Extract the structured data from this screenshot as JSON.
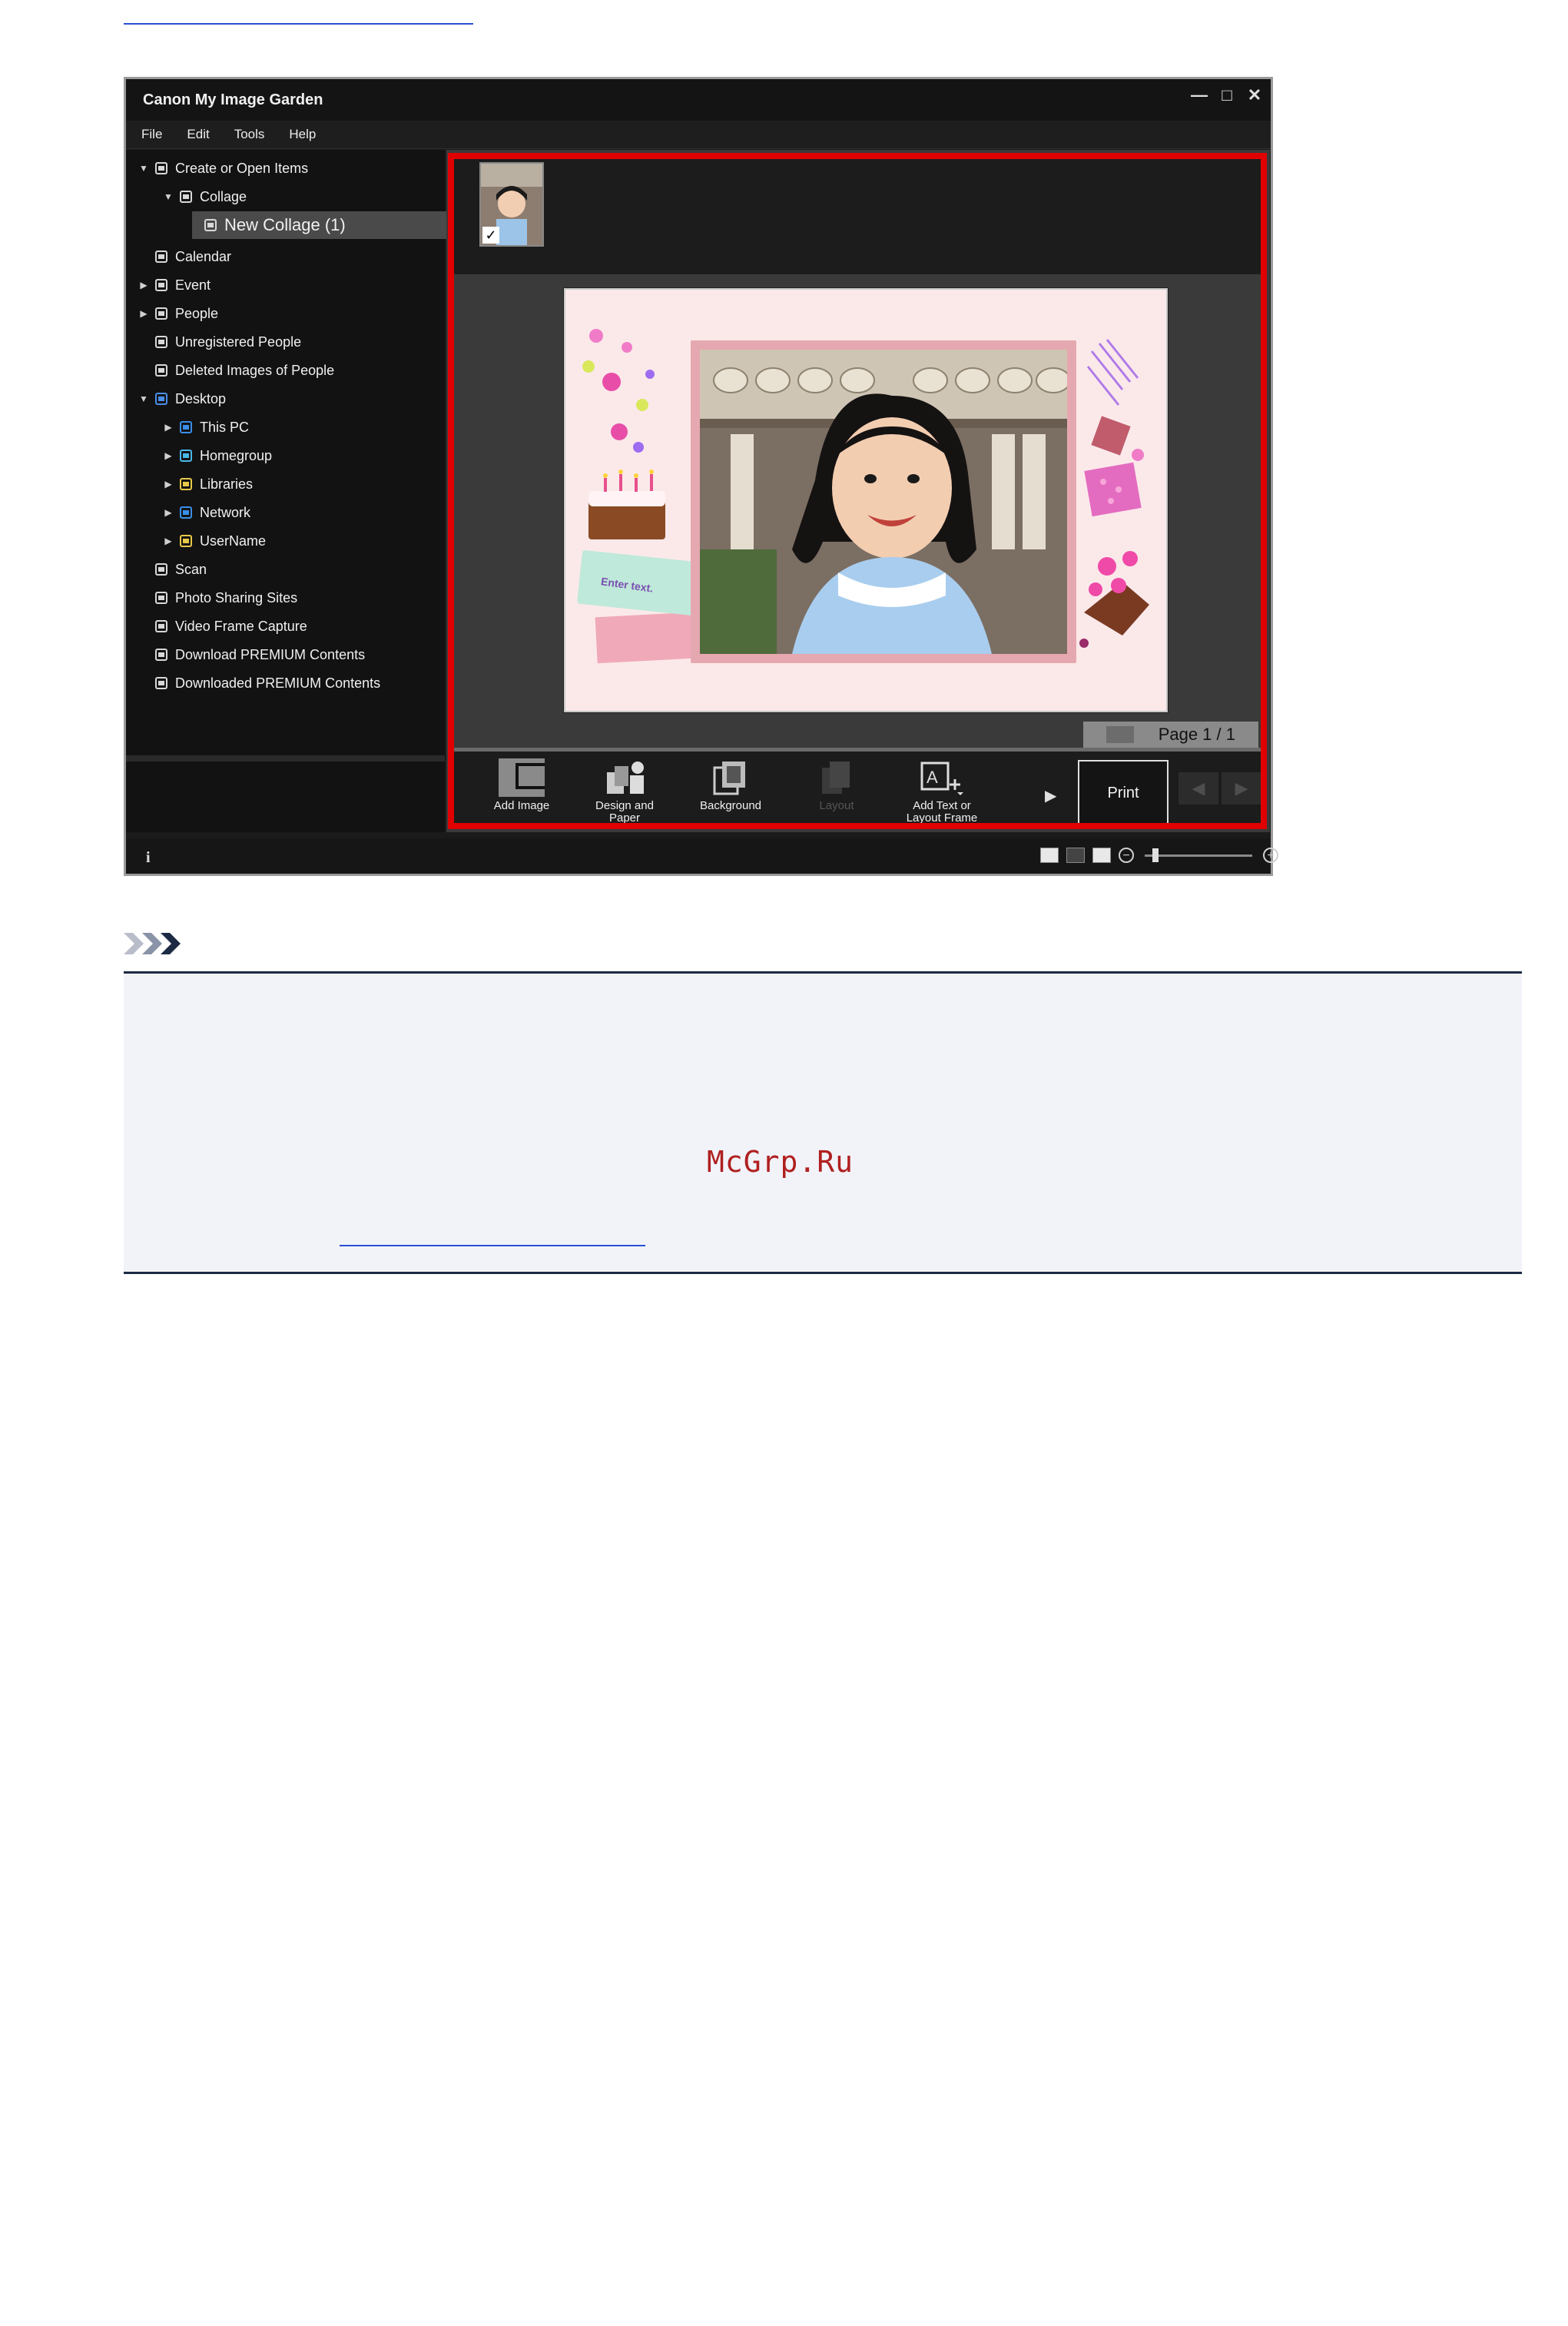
{
  "window": {
    "title": "Canon My Image Garden",
    "controls": [
      "minimize-icon",
      "maximize-icon",
      "close-icon"
    ]
  },
  "menu": [
    "File",
    "Edit",
    "Tools",
    "Help"
  ],
  "sidebar": {
    "items": [
      {
        "label": "Create or Open Items",
        "level": 0,
        "arrow": "down",
        "icon": "create-icon"
      },
      {
        "label": "Collage",
        "level": 1,
        "arrow": "down",
        "icon": "collage-icon"
      },
      {
        "label": "New Collage (1)",
        "level": 2,
        "arrow": "",
        "icon": "collage-item-icon",
        "selected": true
      },
      {
        "label": "Calendar",
        "level": 0,
        "arrow": "",
        "icon": "calendar-icon"
      },
      {
        "label": "Event",
        "level": 0,
        "arrow": "right",
        "icon": "event-icon"
      },
      {
        "label": "People",
        "level": 0,
        "arrow": "right",
        "icon": "person-icon"
      },
      {
        "label": "Unregistered People",
        "level": 0,
        "arrow": "",
        "icon": "unregistered-person-icon"
      },
      {
        "label": "Deleted Images of People",
        "level": 0,
        "arrow": "",
        "icon": "deleted-person-icon"
      },
      {
        "label": "Desktop",
        "level": 0,
        "arrow": "down",
        "icon": "desktop-icon"
      },
      {
        "label": "This PC",
        "level": 1,
        "arrow": "right",
        "icon": "pc-icon"
      },
      {
        "label": "Homegroup",
        "level": 1,
        "arrow": "right",
        "icon": "homegroup-icon"
      },
      {
        "label": "Libraries",
        "level": 1,
        "arrow": "right",
        "icon": "libraries-icon"
      },
      {
        "label": "Network",
        "level": 1,
        "arrow": "right",
        "icon": "network-icon"
      },
      {
        "label": "UserName",
        "level": 1,
        "arrow": "right",
        "icon": "user-folder-icon"
      },
      {
        "label": "Scan",
        "level": 0,
        "arrow": "",
        "icon": "scan-icon"
      },
      {
        "label": "Photo Sharing Sites",
        "level": 0,
        "arrow": "",
        "icon": "photo-sharing-icon"
      },
      {
        "label": "Video Frame Capture",
        "level": 0,
        "arrow": "",
        "icon": "video-frame-icon"
      },
      {
        "label": "Download PREMIUM Contents",
        "level": 0,
        "arrow": "",
        "icon": "download-icon"
      },
      {
        "label": "Downloaded PREMIUM Contents",
        "level": 0,
        "arrow": "",
        "icon": "folder-icon"
      }
    ]
  },
  "canvas": {
    "enter_text": "Enter text.",
    "page_indicator": "Page 1 / 1"
  },
  "toolbar": {
    "buttons": [
      {
        "label": "Add Image",
        "icon": "add-image-icon",
        "enabled": true
      },
      {
        "label": "Design and Paper",
        "icon": "design-paper-icon",
        "enabled": true
      },
      {
        "label": "Background",
        "icon": "background-icon",
        "enabled": true
      },
      {
        "label": "Layout",
        "icon": "layout-icon",
        "enabled": false
      },
      {
        "label": "Add Text or Layout Frame",
        "icon": "add-text-frame-icon",
        "enabled": true
      }
    ],
    "print_label": "Print"
  },
  "watermark": "McGrp.Ru",
  "colors": {
    "highlight_frame": "#e00000",
    "link": "#2a4fd0",
    "note_border": "#1c2a44",
    "note_bg": "#f2f3f9"
  }
}
